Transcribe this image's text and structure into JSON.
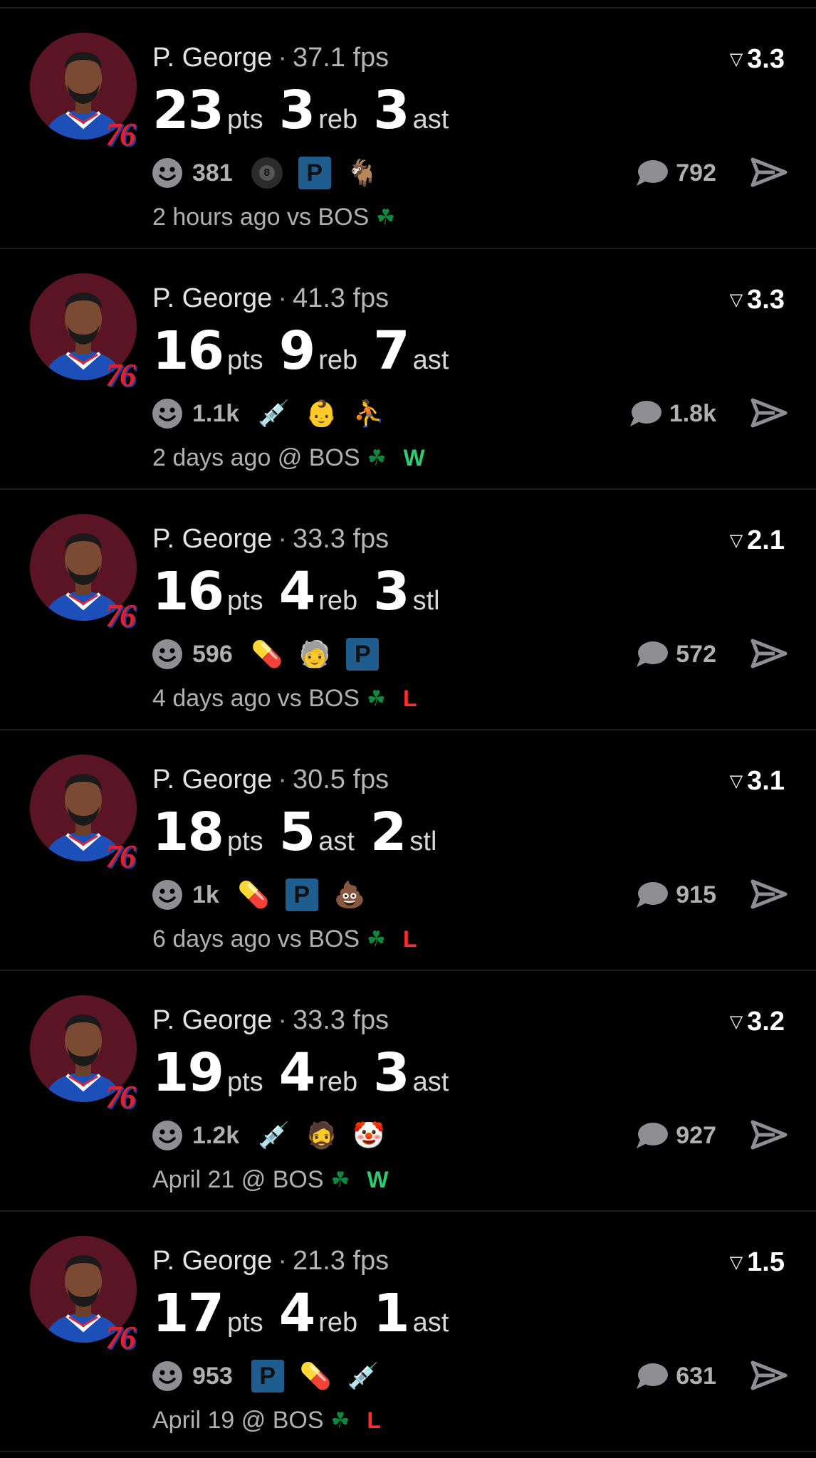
{
  "colors": {
    "background": "#000000",
    "win": "#2ECC71",
    "loss": "#FF2D2D",
    "muted": "#B0B0B0",
    "avatar_bg": "#5A1424"
  },
  "posts": [
    {
      "name": "P. George",
      "separator": "·",
      "fps": "37.1 fps",
      "rating": "3.3",
      "stats": [
        {
          "value": "23",
          "label": "pts"
        },
        {
          "value": "3",
          "label": "reb"
        },
        {
          "value": "3",
          "label": "ast"
        }
      ],
      "likes": "381",
      "comments": "792",
      "time_opponent": "2 hours ago vs BOS",
      "result": "",
      "reactions": [
        "8-ball-icon",
        "parking-sign-icon",
        "goat-icon"
      ]
    },
    {
      "name": "P. George",
      "separator": "·",
      "fps": "41.3 fps",
      "rating": "3.3",
      "stats": [
        {
          "value": "16",
          "label": "pts"
        },
        {
          "value": "9",
          "label": "reb"
        },
        {
          "value": "7",
          "label": "ast"
        }
      ],
      "likes": "1.1k",
      "comments": "1.8k",
      "time_opponent": "2 days ago @ BOS",
      "result": "W",
      "reactions": [
        "syringe-icon",
        "baby-face-icon",
        "player-silhouette-icon"
      ]
    },
    {
      "name": "P. George",
      "separator": "·",
      "fps": "33.3 fps",
      "rating": "2.1",
      "stats": [
        {
          "value": "16",
          "label": "pts"
        },
        {
          "value": "4",
          "label": "reb"
        },
        {
          "value": "3",
          "label": "stl"
        }
      ],
      "likes": "596",
      "comments": "572",
      "time_opponent": "4 days ago vs BOS",
      "result": "L",
      "reactions": [
        "pill-icon",
        "elderly-walker-icon",
        "parking-sign-icon"
      ]
    },
    {
      "name": "P. George",
      "separator": "·",
      "fps": "30.5 fps",
      "rating": "3.1",
      "stats": [
        {
          "value": "18",
          "label": "pts"
        },
        {
          "value": "5",
          "label": "ast"
        },
        {
          "value": "2",
          "label": "stl"
        }
      ],
      "likes": "1k",
      "comments": "915",
      "time_opponent": "6 days ago vs BOS",
      "result": "L",
      "reactions": [
        "pill-icon",
        "parking-sign-icon",
        "poop-icon"
      ]
    },
    {
      "name": "P. George",
      "separator": "·",
      "fps": "33.3 fps",
      "rating": "3.2",
      "stats": [
        {
          "value": "19",
          "label": "pts"
        },
        {
          "value": "4",
          "label": "reb"
        },
        {
          "value": "3",
          "label": "ast"
        }
      ],
      "likes": "1.2k",
      "comments": "927",
      "time_opponent": "April 21 @ BOS",
      "result": "W",
      "reactions": [
        "syringe-icon",
        "person-photo-icon",
        "clown-icon"
      ]
    },
    {
      "name": "P. George",
      "separator": "·",
      "fps": "21.3 fps",
      "rating": "1.5",
      "stats": [
        {
          "value": "17",
          "label": "pts"
        },
        {
          "value": "4",
          "label": "reb"
        },
        {
          "value": "1",
          "label": "ast"
        }
      ],
      "likes": "953",
      "comments": "631",
      "time_opponent": "April 19 @ BOS",
      "result": "L",
      "reactions": [
        "parking-sign-icon",
        "pill-icon",
        "syringe-icon"
      ]
    }
  ]
}
